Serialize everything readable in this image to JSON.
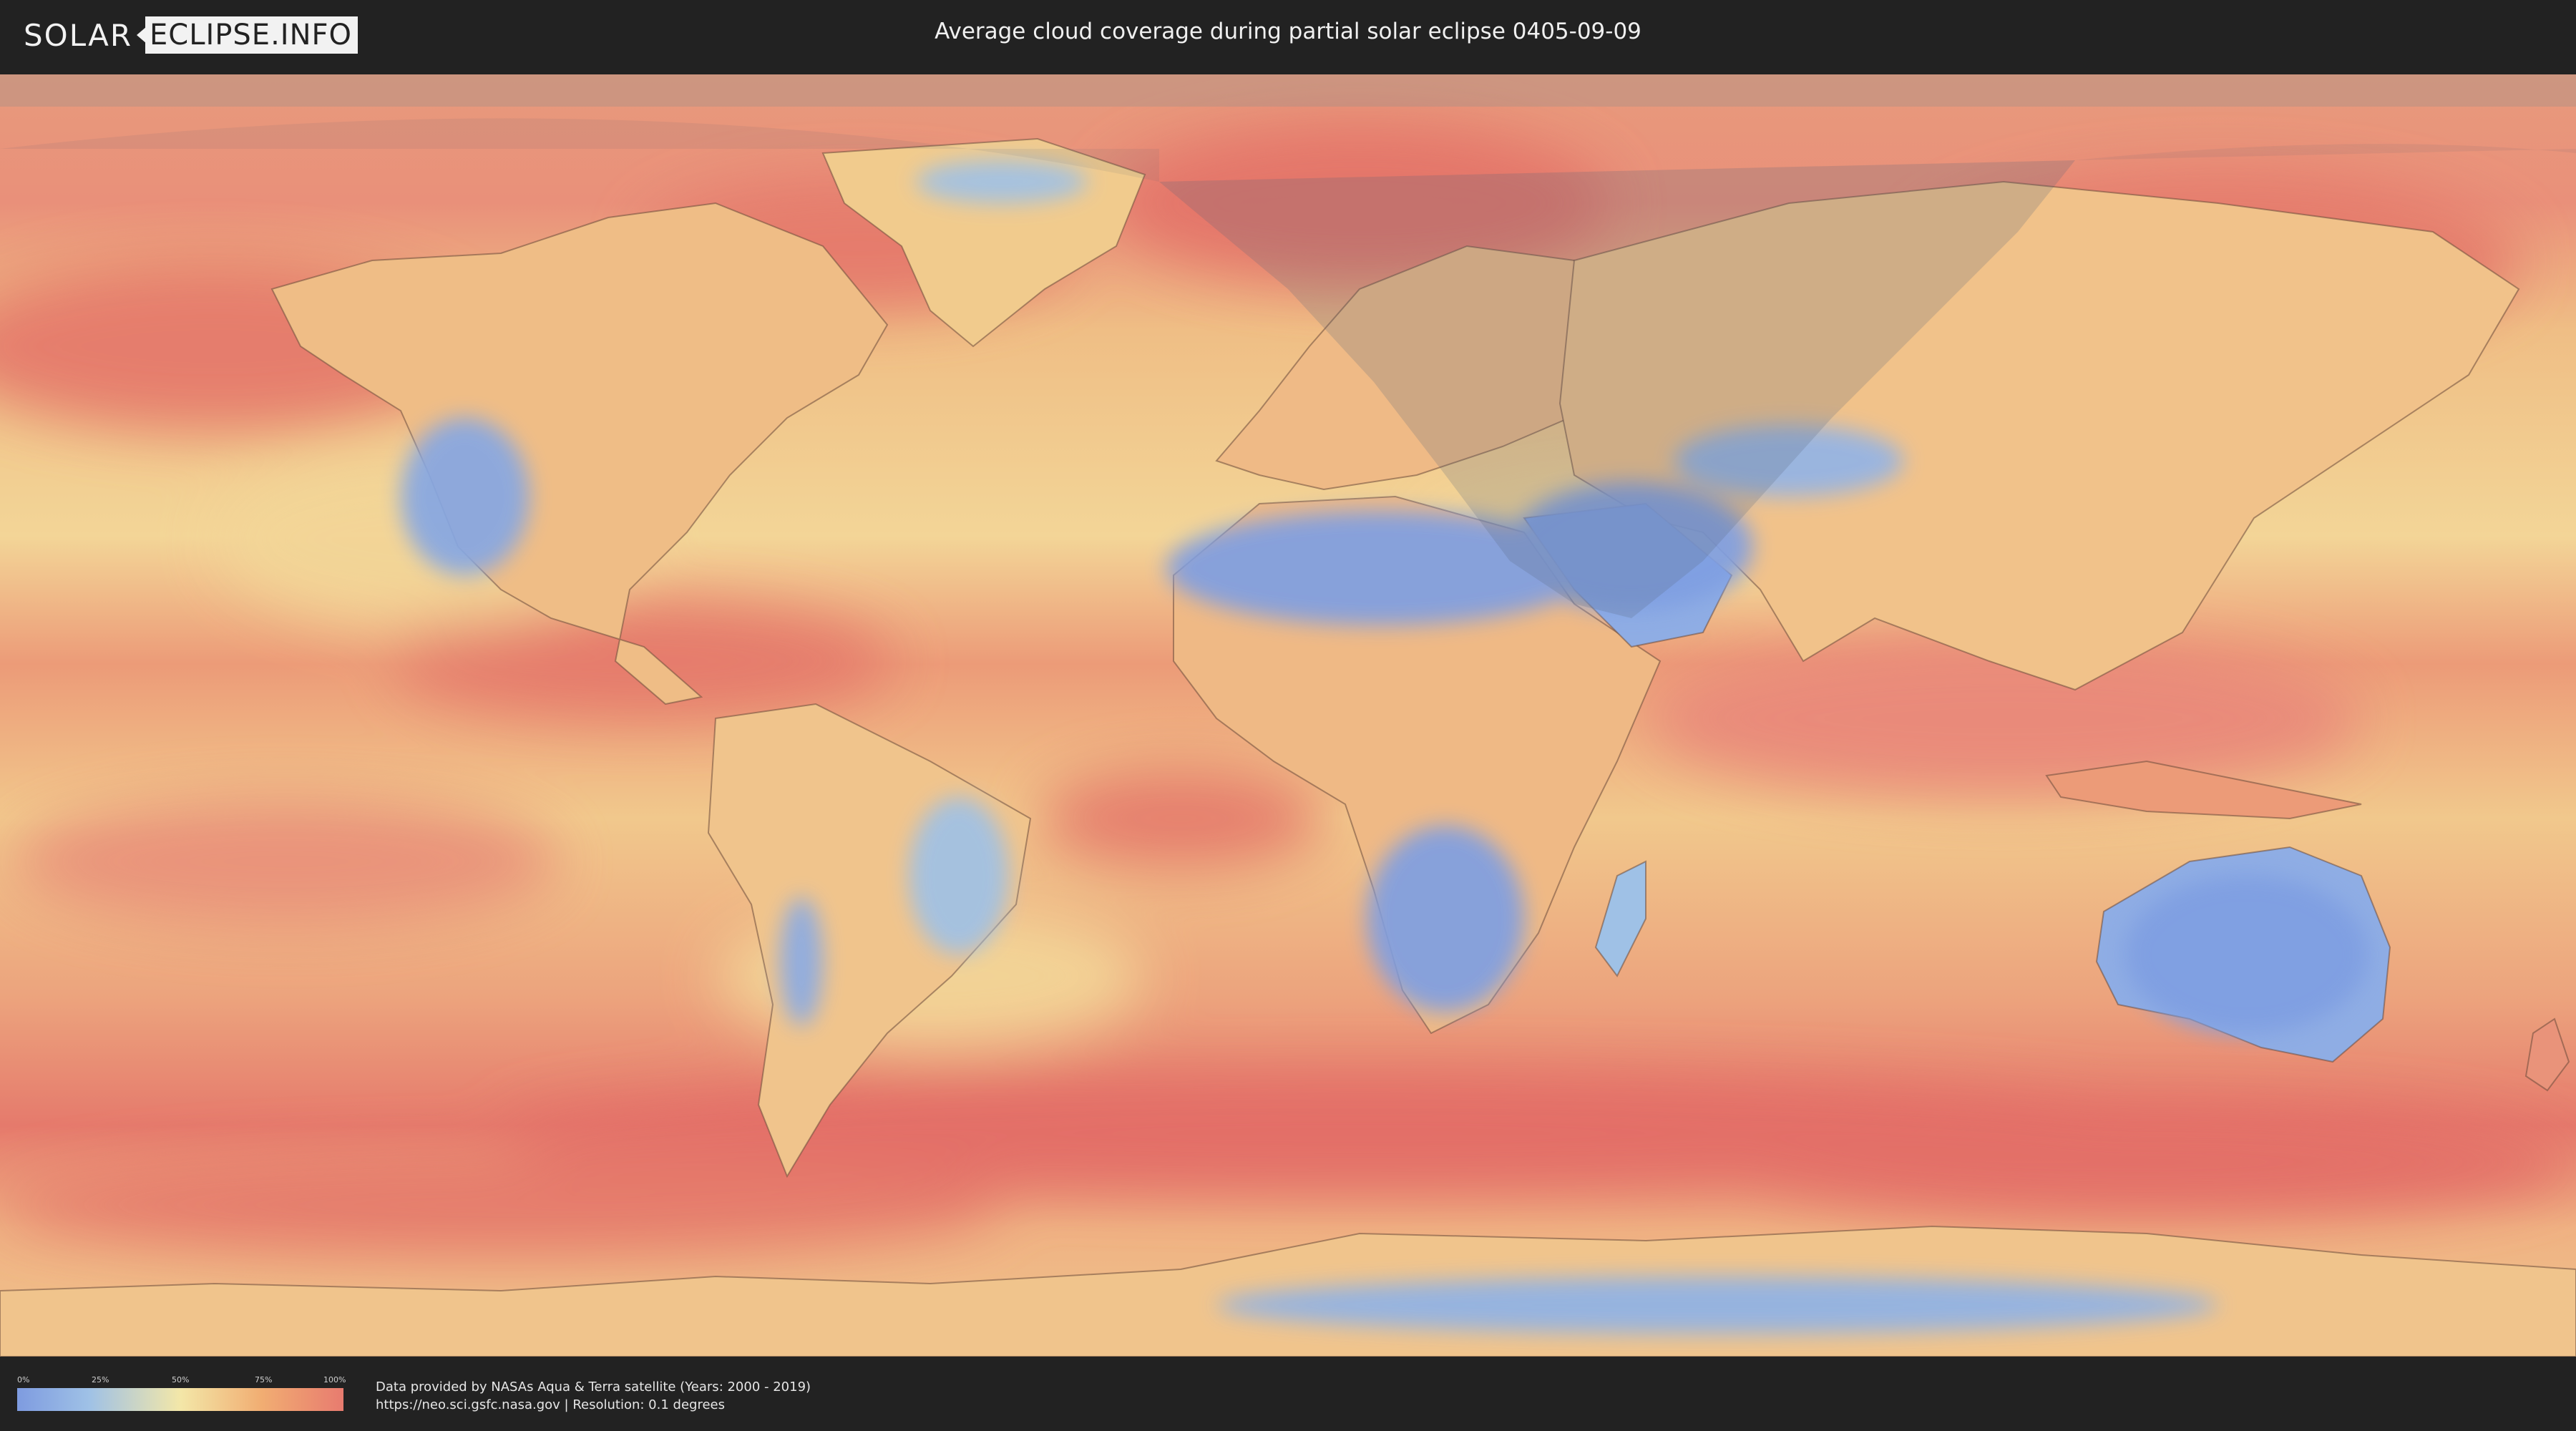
{
  "header": {
    "logo_left": "SOLAR",
    "logo_right": "ECLIPSE.INFO",
    "title": "Average cloud coverage during partial solar eclipse 0405-09-09"
  },
  "legend": {
    "ticks": [
      "0%",
      "25%",
      "50%",
      "75%",
      "100%"
    ],
    "colors": [
      "#7e9be0",
      "#9fc1e6",
      "#f3e7a8",
      "#f1ad72",
      "#e87b6f"
    ]
  },
  "credits": {
    "line1": "Data provided by NASAs Aqua & Terra satellite (Years: 2000 - 2019)",
    "line2": "https://neo.sci.gsfc.nasa.gov | Resolution: 0.1 degrees"
  },
  "map": {
    "projection": "equirectangular",
    "colors": {
      "clear": "#7f9fe2",
      "mid": "#f2d59a",
      "cloudy": "#e6776c",
      "land_outline": "#6b4a3a",
      "eclipse_shadow": "#6e7f9a"
    }
  }
}
